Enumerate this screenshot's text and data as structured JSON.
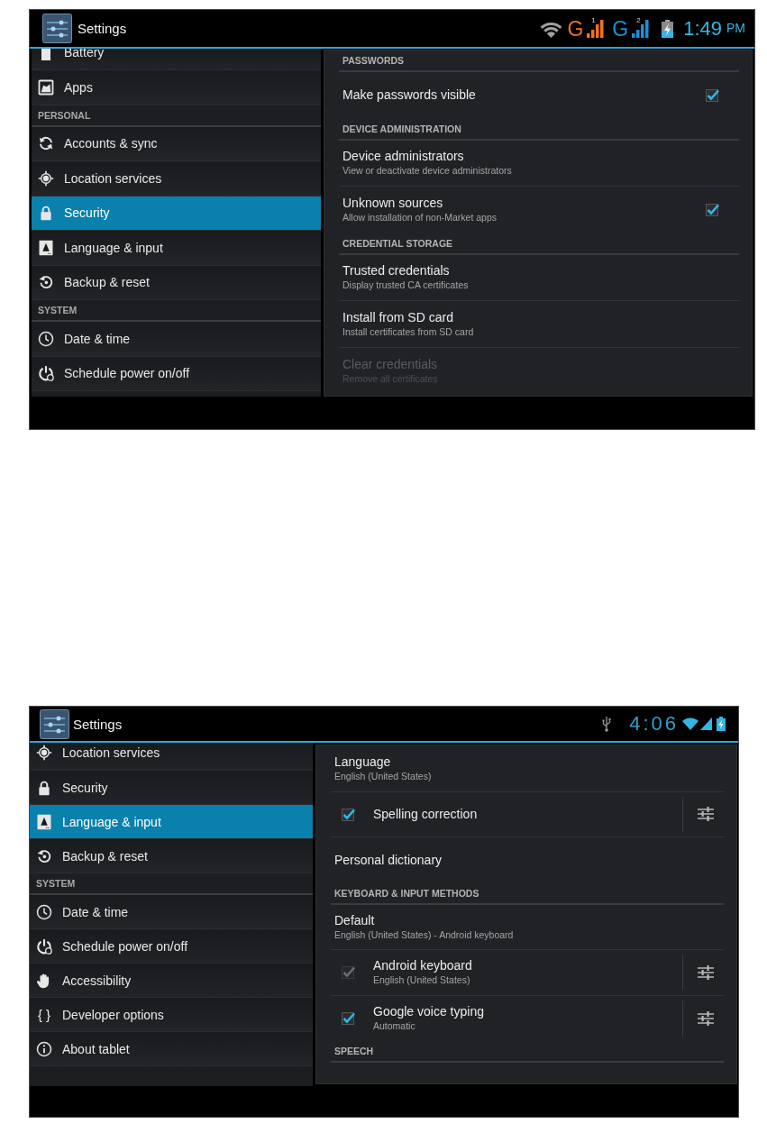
{
  "screens": [
    {
      "action_bar": {
        "title": "Settings"
      },
      "status_bar": {
        "kind": "dual",
        "networks": [
          {
            "label": "G",
            "slot": "1",
            "color": "#f2711c"
          },
          {
            "label": "G",
            "slot": "2",
            "color": "#1b91d8"
          }
        ],
        "time": "1:49",
        "meridiem": "PM"
      },
      "sidebar": {
        "items": [
          {
            "kind": "item",
            "label": "Battery",
            "selected": false
          },
          {
            "kind": "item",
            "label": "Apps",
            "selected": false
          },
          {
            "kind": "header",
            "label": "PERSONAL"
          },
          {
            "kind": "item",
            "label": "Accounts & sync",
            "selected": false
          },
          {
            "kind": "item",
            "label": "Location services",
            "selected": false
          },
          {
            "kind": "item",
            "label": "Security",
            "selected": true
          },
          {
            "kind": "item",
            "label": "Language & input",
            "selected": false
          },
          {
            "kind": "item",
            "label": "Backup & reset",
            "selected": false
          },
          {
            "kind": "header",
            "label": "SYSTEM"
          },
          {
            "kind": "item",
            "label": "Date & time",
            "selected": false
          },
          {
            "kind": "item",
            "label": "Schedule power on/off",
            "selected": false
          }
        ]
      },
      "panel": {
        "rows": [
          {
            "kind": "header",
            "label": "PASSWORDS"
          },
          {
            "kind": "toggle",
            "title": "Make passwords visible",
            "checked": true,
            "disabled": false
          },
          {
            "kind": "header",
            "label": "DEVICE ADMINISTRATION"
          },
          {
            "kind": "item",
            "title": "Device administrators",
            "summary": "View or deactivate device administrators",
            "disabled": false
          },
          {
            "kind": "toggle",
            "title": "Unknown sources",
            "summary": "Allow installation of non-Market apps",
            "checked": true,
            "disabled": false
          },
          {
            "kind": "header",
            "label": "CREDENTIAL STORAGE"
          },
          {
            "kind": "item",
            "title": "Trusted credentials",
            "summary": "Display trusted CA certificates",
            "disabled": false
          },
          {
            "kind": "item",
            "title": "Install from SD card",
            "summary": "Install certificates from SD card",
            "disabled": false
          },
          {
            "kind": "item",
            "title": "Clear credentials",
            "summary": "Remove all certificates",
            "disabled": true
          }
        ]
      }
    },
    {
      "action_bar": {
        "title": "Settings"
      },
      "status_bar": {
        "kind": "single",
        "time": "4:06"
      },
      "sidebar": {
        "items": [
          {
            "kind": "item",
            "label": "Location services",
            "selected": false
          },
          {
            "kind": "item",
            "label": "Security",
            "selected": false
          },
          {
            "kind": "item",
            "label": "Language & input",
            "selected": true
          },
          {
            "kind": "item",
            "label": "Backup & reset",
            "selected": false
          },
          {
            "kind": "header",
            "label": "SYSTEM"
          },
          {
            "kind": "item",
            "label": "Date & time",
            "selected": false
          },
          {
            "kind": "item",
            "label": "Schedule power on/off",
            "selected": false
          },
          {
            "kind": "item",
            "label": "Accessibility",
            "selected": false
          },
          {
            "kind": "item",
            "label": "Developer options",
            "glyph": "{ }",
            "selected": false
          },
          {
            "kind": "item",
            "label": "About tablet",
            "selected": false
          }
        ]
      },
      "panel": {
        "rows": [
          {
            "kind": "item",
            "title": "Language",
            "summary": "English (United States)",
            "disabled": false
          },
          {
            "kind": "method",
            "title": "Spelling correction",
            "checked": true,
            "disabled": false
          },
          {
            "kind": "item",
            "title": "Personal dictionary",
            "disabled": false
          },
          {
            "kind": "header",
            "label": "KEYBOARD & INPUT METHODS"
          },
          {
            "kind": "item",
            "title": "Default",
            "summary": "English (United States) - Android keyboard",
            "disabled": false
          },
          {
            "kind": "method",
            "title": "Android keyboard",
            "summary": "English (United States)",
            "checked": true,
            "disabled": true
          },
          {
            "kind": "method",
            "title": "Google voice typing",
            "summary": "Automatic",
            "checked": true,
            "disabled": false
          },
          {
            "kind": "header",
            "label": "SPEECH"
          }
        ]
      }
    }
  ]
}
